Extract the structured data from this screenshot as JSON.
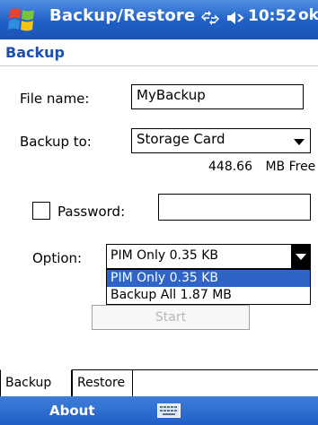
{
  "window": {
    "title": "Backup/Restore",
    "time": "10:52",
    "ok_label": "ok"
  },
  "header": {
    "title": "Backup"
  },
  "form": {
    "file_name_label": "File name:",
    "file_name_value": "MyBackup",
    "backup_to_label": "Backup to:",
    "backup_to_value": "Storage Card",
    "free_space_value": "448.66",
    "free_space_unit": "MB Free",
    "password_label": "Password:",
    "password_value": "",
    "option_label": "Option:",
    "option_selected": "PIM Only  0.35 KB",
    "option_list": [
      "PIM Only  0.35 KB",
      "Backup All  1.87 MB"
    ],
    "start_label": "Start"
  },
  "tabs": [
    "Backup",
    "Restore"
  ],
  "menubar": {
    "left_label": "About"
  },
  "icons": {
    "logo": "windows-flag-icon",
    "connectivity": "connectivity-icon",
    "volume": "volume-icon",
    "keyboard": "keyboard-icon",
    "dropdown": "chevron-down-icon"
  },
  "colors": {
    "titlebar": "#1f5fc6",
    "header_text": "#1e4fae",
    "selection": "#2f63c6",
    "disabled_text": "#b8b8b8"
  }
}
